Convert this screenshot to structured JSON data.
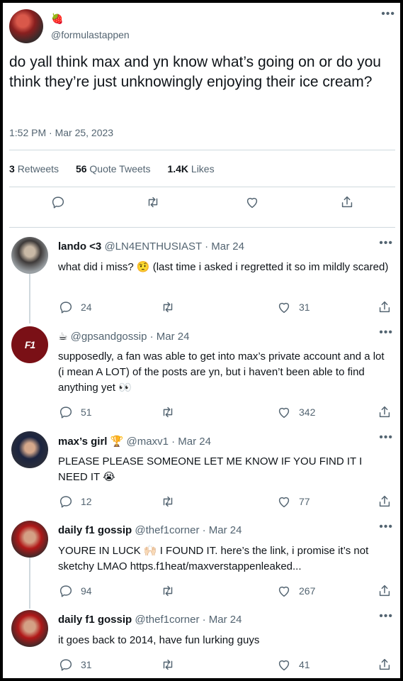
{
  "main": {
    "emoji": "🍓",
    "handle": "@formulastappen",
    "text": "do yall think max and yn know what’s going on or do you think they’re just unknowingly enjoying their ice cream?",
    "time": "1:52 PM · Mar 25, 2023",
    "stats": {
      "retweets_count": "3",
      "retweets_label": "Retweets",
      "quotes_count": "56",
      "quotes_label": "Quote Tweets",
      "likes_count": "1.4K",
      "likes_label": "Likes"
    },
    "more": "•••"
  },
  "replies": [
    {
      "name": "lando <3",
      "meta": "@LN4ENTHUSIAST · Mar 24",
      "text": "what did i miss? 🤨 (last time i asked i regretted it so im mildly scared)",
      "replies": "24",
      "likes": "31"
    },
    {
      "name": "☕",
      "meta": "@gpsandgossip · Mar 24",
      "avatar_text": "F1",
      "text": "supposedly, a fan was able to get into max’s private account and a lot (i mean A LOT) of the posts are yn, but i haven’t been able to find anything yet 👀",
      "replies": "51",
      "likes": "342"
    },
    {
      "name": "max’s girl 🏆",
      "meta": "@maxv1 · Mar 24",
      "text": "PLEASE PLEASE SOMEONE LET ME KNOW IF YOU FIND IT I NEED IT 😭",
      "replies": "12",
      "likes": "77"
    },
    {
      "name": "daily f1 gossip",
      "meta": "@thef1corner · Mar 24",
      "text": "YOURE IN LUCK 🙌🏻 I FOUND IT. here’s the link, i promise it’s not sketchy LMAO https.f1heat/maxverstappenleaked...",
      "replies": "94",
      "likes": "267"
    },
    {
      "name": "daily f1 gossip",
      "meta": "@thef1corner · Mar 24",
      "text": "it goes back to 2014, have fun lurking guys",
      "replies": "31",
      "likes": "41"
    }
  ],
  "icons": {
    "reply": "reply-icon",
    "retweet": "retweet-icon",
    "like": "heart-icon",
    "share": "share-icon",
    "more": "more-icon"
  },
  "colors": {
    "muted": "#536471",
    "text": "#0f1419",
    "divider": "#cfd9de"
  }
}
